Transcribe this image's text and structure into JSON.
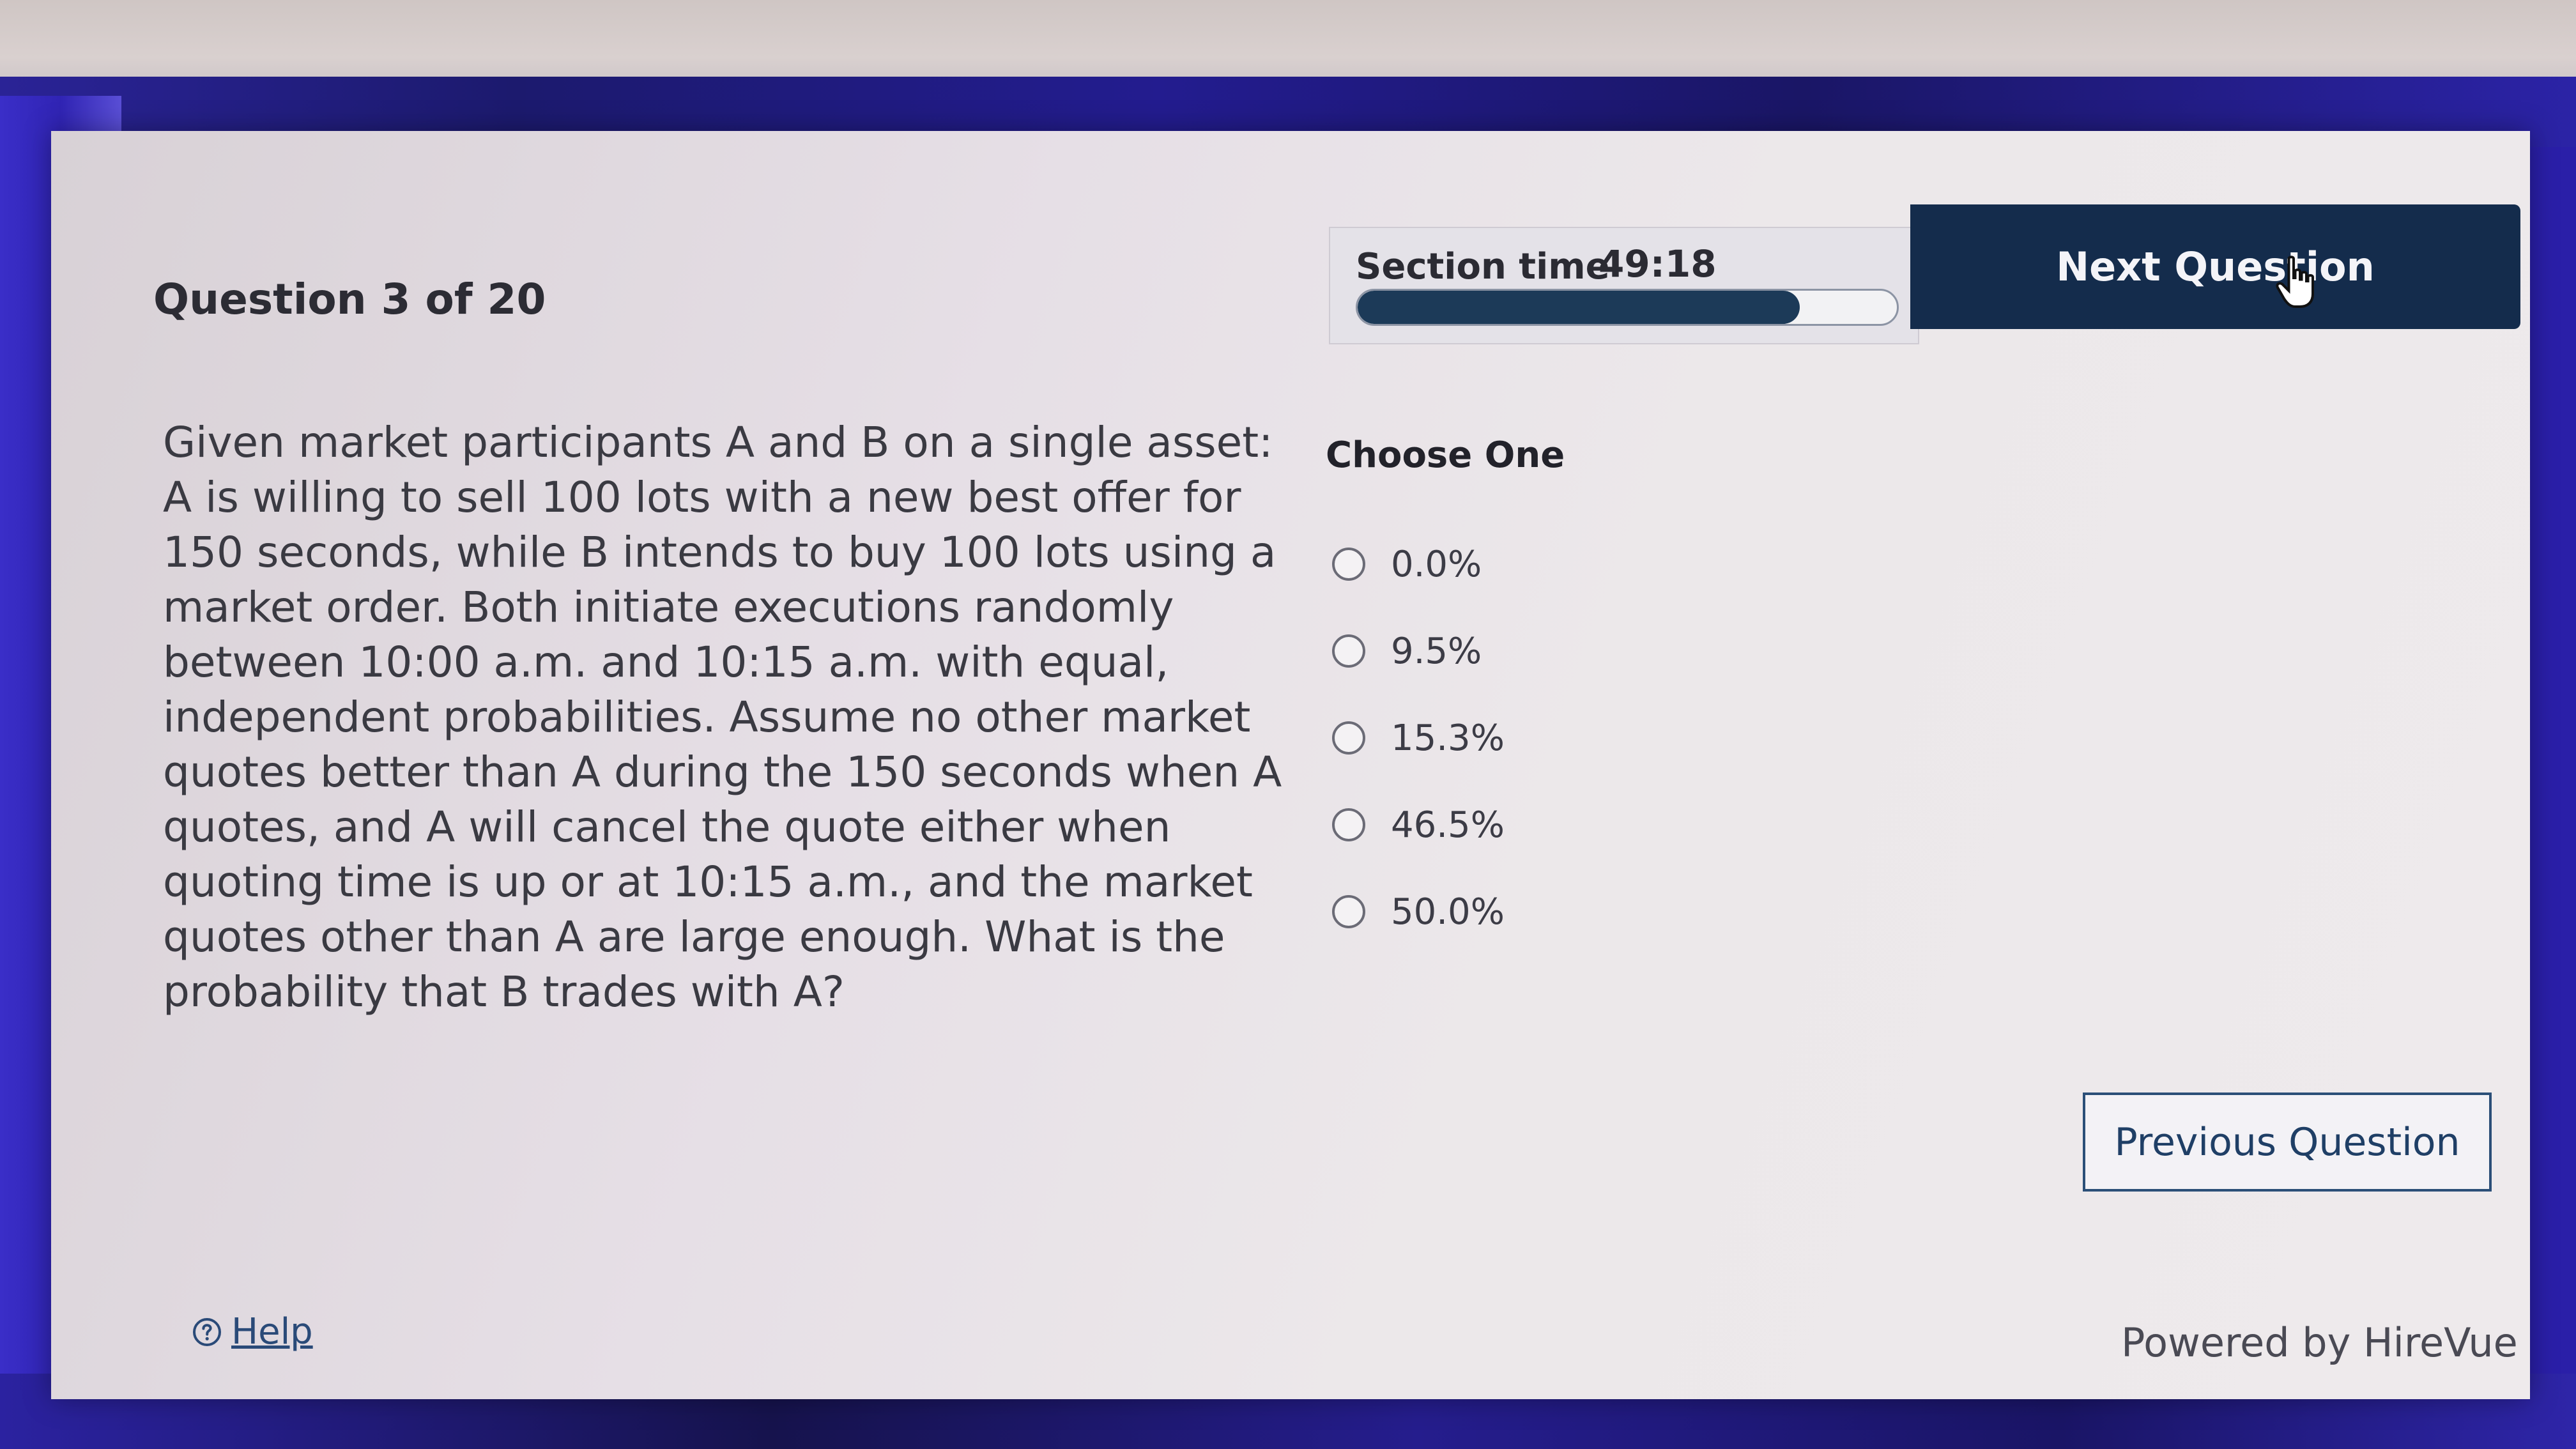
{
  "header": {
    "question_counter": "Question 3 of 20",
    "section_time_label": "Section time",
    "section_time_value": "49:18",
    "time_progress_fraction": 0.82,
    "next_button_label": "Next Question"
  },
  "question": {
    "text": "Given market participants A and B on a single asset: A is willing to sell 100 lots with a new best offer for 150 seconds, while B intends to buy 100 lots using a market order. Both initiate executions randomly between 10:00 a.m. and 10:15 a.m. with equal, independent probabilities. Assume no other market quotes better than A during the 150 seconds when A quotes, and A will cancel the quote either when quoting time is up or at 10:15 a.m., and the market quotes other than A are large enough. What is the probability that B trades with A?"
  },
  "answers": {
    "prompt": "Choose One",
    "options": [
      "0.0%",
      "9.5%",
      "15.3%",
      "46.5%",
      "50.0%"
    ]
  },
  "footer": {
    "previous_button_label": "Previous Question",
    "help_label": "Help",
    "powered_by": "Powered by HireVue"
  },
  "icons": {
    "help": "question-circle-icon",
    "cursor": "hand-pointer-icon"
  },
  "colors": {
    "primary_dark": "#142c4c",
    "link": "#2a4a78"
  }
}
